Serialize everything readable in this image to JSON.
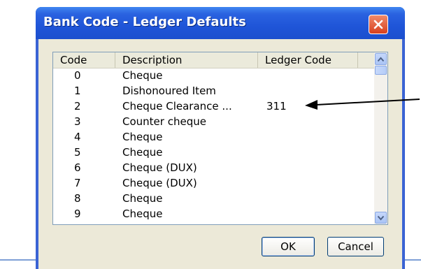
{
  "dialog": {
    "title": "Bank Code - Ledger Defaults",
    "ok_label": "OK",
    "cancel_label": "Cancel"
  },
  "list": {
    "columns": [
      "Code",
      "Description",
      "Ledger Code"
    ],
    "rows": [
      {
        "code": "0",
        "description": "Cheque",
        "ledger": ""
      },
      {
        "code": "1",
        "description": "Dishonoured Item",
        "ledger": ""
      },
      {
        "code": "2",
        "description": "Cheque Clearance ...",
        "ledger": "311"
      },
      {
        "code": "3",
        "description": "Counter cheque",
        "ledger": ""
      },
      {
        "code": "4",
        "description": "Cheque",
        "ledger": ""
      },
      {
        "code": "5",
        "description": "Cheque",
        "ledger": ""
      },
      {
        "code": "6",
        "description": "Cheque (DUX)",
        "ledger": ""
      },
      {
        "code": "7",
        "description": "Cheque (DUX)",
        "ledger": ""
      },
      {
        "code": "8",
        "description": "Cheque",
        "ledger": ""
      },
      {
        "code": "9",
        "description": "Cheque",
        "ledger": ""
      }
    ]
  },
  "icons": {
    "close": "close-icon",
    "scroll_up": "chevron-up-icon",
    "scroll_down": "chevron-down-icon",
    "annotation": "arrow-icon"
  },
  "colors": {
    "titlebar": "#2a62e0",
    "close_button": "#d8401e",
    "dialog_face": "#ece9d8",
    "annotation_arrow": "#000000"
  }
}
